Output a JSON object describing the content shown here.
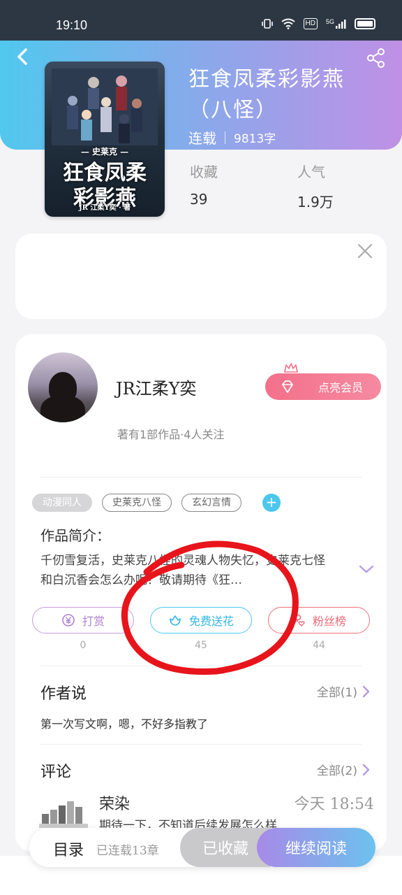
{
  "status_bar": {
    "time": "19:10",
    "network": "5G",
    "hd": "HD"
  },
  "book": {
    "title": "狂食凤柔彩影燕（八怪）",
    "status": "连载",
    "words": "9813字",
    "stats": [
      {
        "label": "收藏",
        "value": "39"
      },
      {
        "label": "人气",
        "value": "1.9万"
      }
    ],
    "cover": {
      "series": "— 史莱克 —",
      "title_line1": "狂食凤柔",
      "title_line2": "彩影燕",
      "author": "JR 江柔Y奕 · 著"
    }
  },
  "author": {
    "name": "JR江柔Y奕",
    "sub": "著有1部作品·4人关注",
    "vip_label": "点亮会员"
  },
  "tags": [
    "动漫同人",
    "史莱克八怪",
    "玄幻言情"
  ],
  "intro": {
    "label": "作品简介：",
    "text": "千仞雪复活，史莱克八怪的灵魂人物失忆，史莱克七怪和白沉香会怎么办呢？敬请期待《狂…"
  },
  "actions": {
    "tip": {
      "label": "打赏",
      "count": "0"
    },
    "flower": {
      "label": "免费送花",
      "count": "45"
    },
    "fans": {
      "label": "粉丝榜",
      "count": "44"
    }
  },
  "author_say": {
    "title": "作者说",
    "more": "全部(1)",
    "text": "第一次写文啊，嗯，不好多指教了"
  },
  "comments": {
    "title": "评论",
    "more": "全部(2)",
    "first": {
      "name": "荣染",
      "time": "今天 18:54",
      "text": "期待一下，不知道后续发展怎么样"
    }
  },
  "bottom": {
    "catalog": "目录",
    "chapters": "已连载13章",
    "collected": "已收藏",
    "read": "继续阅读"
  },
  "colors": {
    "hero_start": "#51c8ee",
    "hero_end": "#c090e6",
    "flower_accent": "#4cc7ee",
    "vip_pink": "#f4708a",
    "annotation_red": "#e8141b"
  }
}
